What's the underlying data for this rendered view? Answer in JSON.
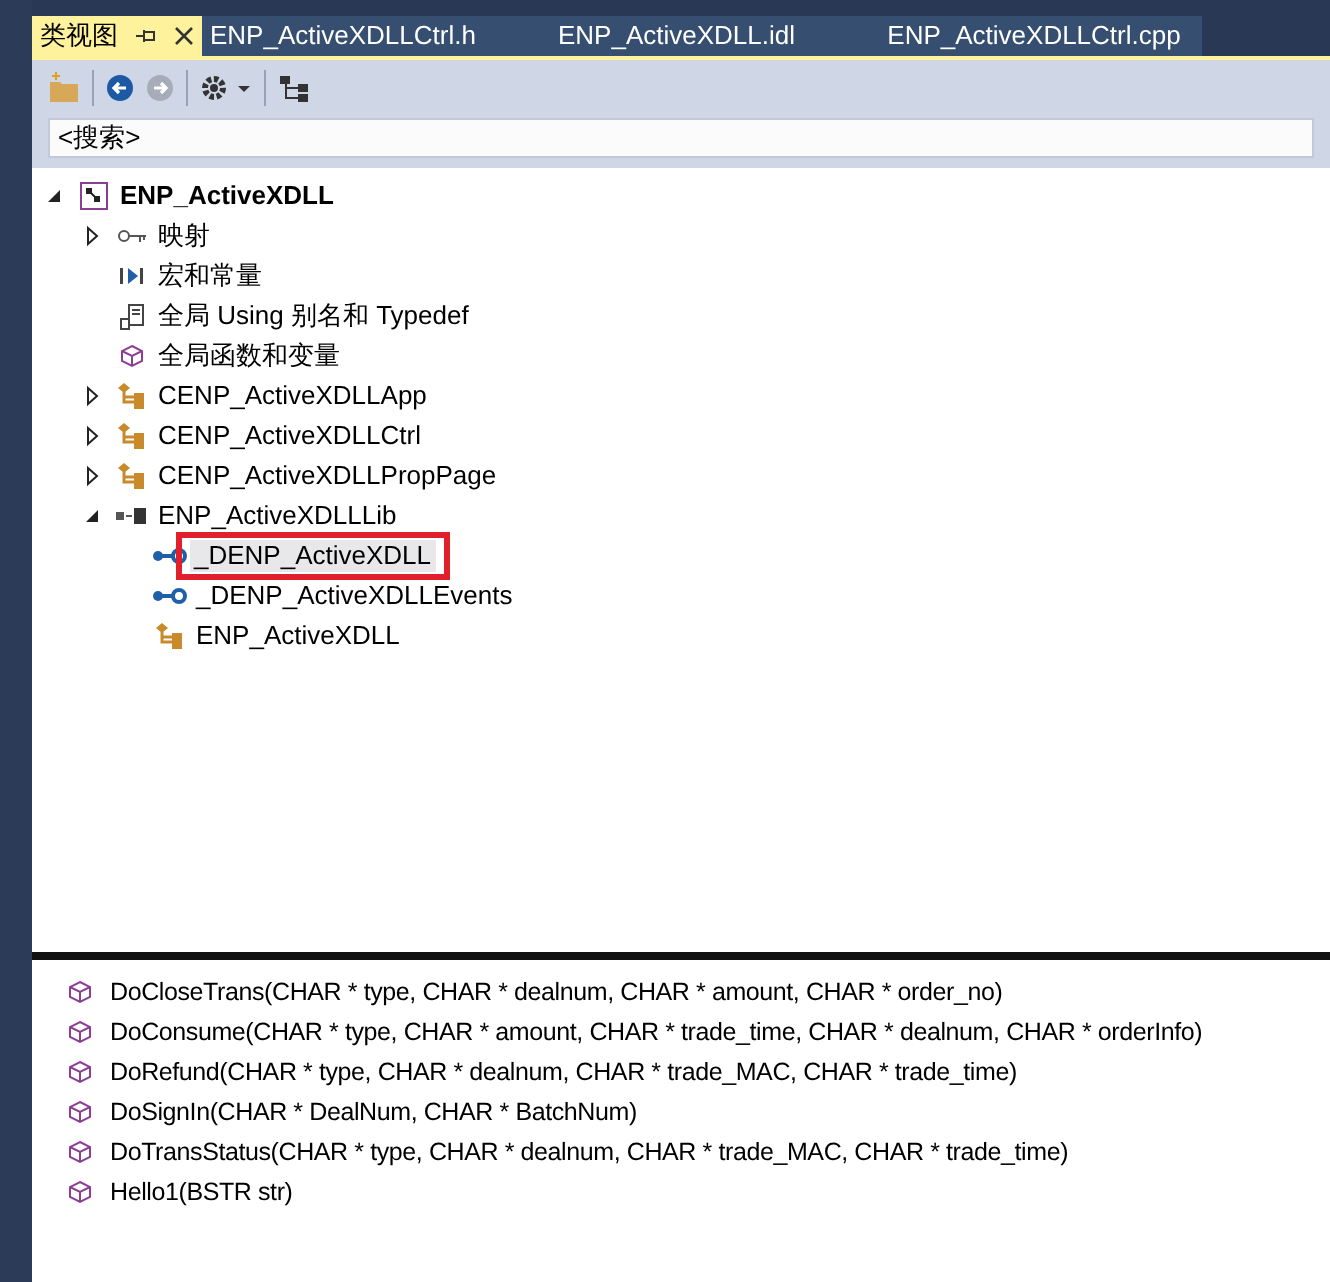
{
  "tabs": [
    {
      "label": "类视图",
      "selected": true,
      "pinned": true
    },
    {
      "label": "ENP_ActiveXDLLCtrl.h",
      "selected": false,
      "pinned": false
    },
    {
      "label": "ENP_ActiveXDLL.idl",
      "selected": false,
      "pinned": false
    },
    {
      "label": "ENP_ActiveXDLLCtrl.cpp",
      "selected": false,
      "pinned": false
    }
  ],
  "search": {
    "placeholder": "<搜索>"
  },
  "tree": [
    {
      "label": "ENP_ActiveXDLL",
      "kind": "project",
      "expanded": true,
      "children": [
        {
          "label": "映射",
          "kind": "map",
          "expanded": false
        },
        {
          "label": "宏和常量",
          "kind": "macro"
        },
        {
          "label": "全局 Using 别名和 Typedef",
          "kind": "typedef"
        },
        {
          "label": "全局函数和变量",
          "kind": "global"
        },
        {
          "label": "CENP_ActiveXDLLApp",
          "kind": "class",
          "expanded": false
        },
        {
          "label": "CENP_ActiveXDLLCtrl",
          "kind": "class",
          "expanded": false
        },
        {
          "label": "CENP_ActiveXDLLPropPage",
          "kind": "class",
          "expanded": false
        },
        {
          "label": "ENP_ActiveXDLLLib",
          "kind": "library",
          "expanded": true,
          "children": [
            {
              "label": "_DENP_ActiveXDLL",
              "kind": "interface",
              "highlighted": true,
              "selected": true
            },
            {
              "label": "_DENP_ActiveXDLLEvents",
              "kind": "interface",
              "selected": false
            },
            {
              "label": "ENP_ActiveXDLL",
              "kind": "class",
              "selected": false
            }
          ]
        }
      ]
    }
  ],
  "members": [
    "DoCloseTrans(CHAR * type, CHAR * dealnum, CHAR * amount, CHAR * order_no)",
    "DoConsume(CHAR * type, CHAR * amount, CHAR * trade_time, CHAR * dealnum, CHAR * orderInfo)",
    "DoRefund(CHAR * type, CHAR * dealnum, CHAR * trade_MAC, CHAR * trade_time)",
    "DoSignIn(CHAR * DealNum, CHAR * BatchNum)",
    "DoTransStatus(CHAR * type, CHAR * dealnum, CHAR * trade_MAC, CHAR * trade_time)",
    "Hello1(BSTR str)"
  ]
}
